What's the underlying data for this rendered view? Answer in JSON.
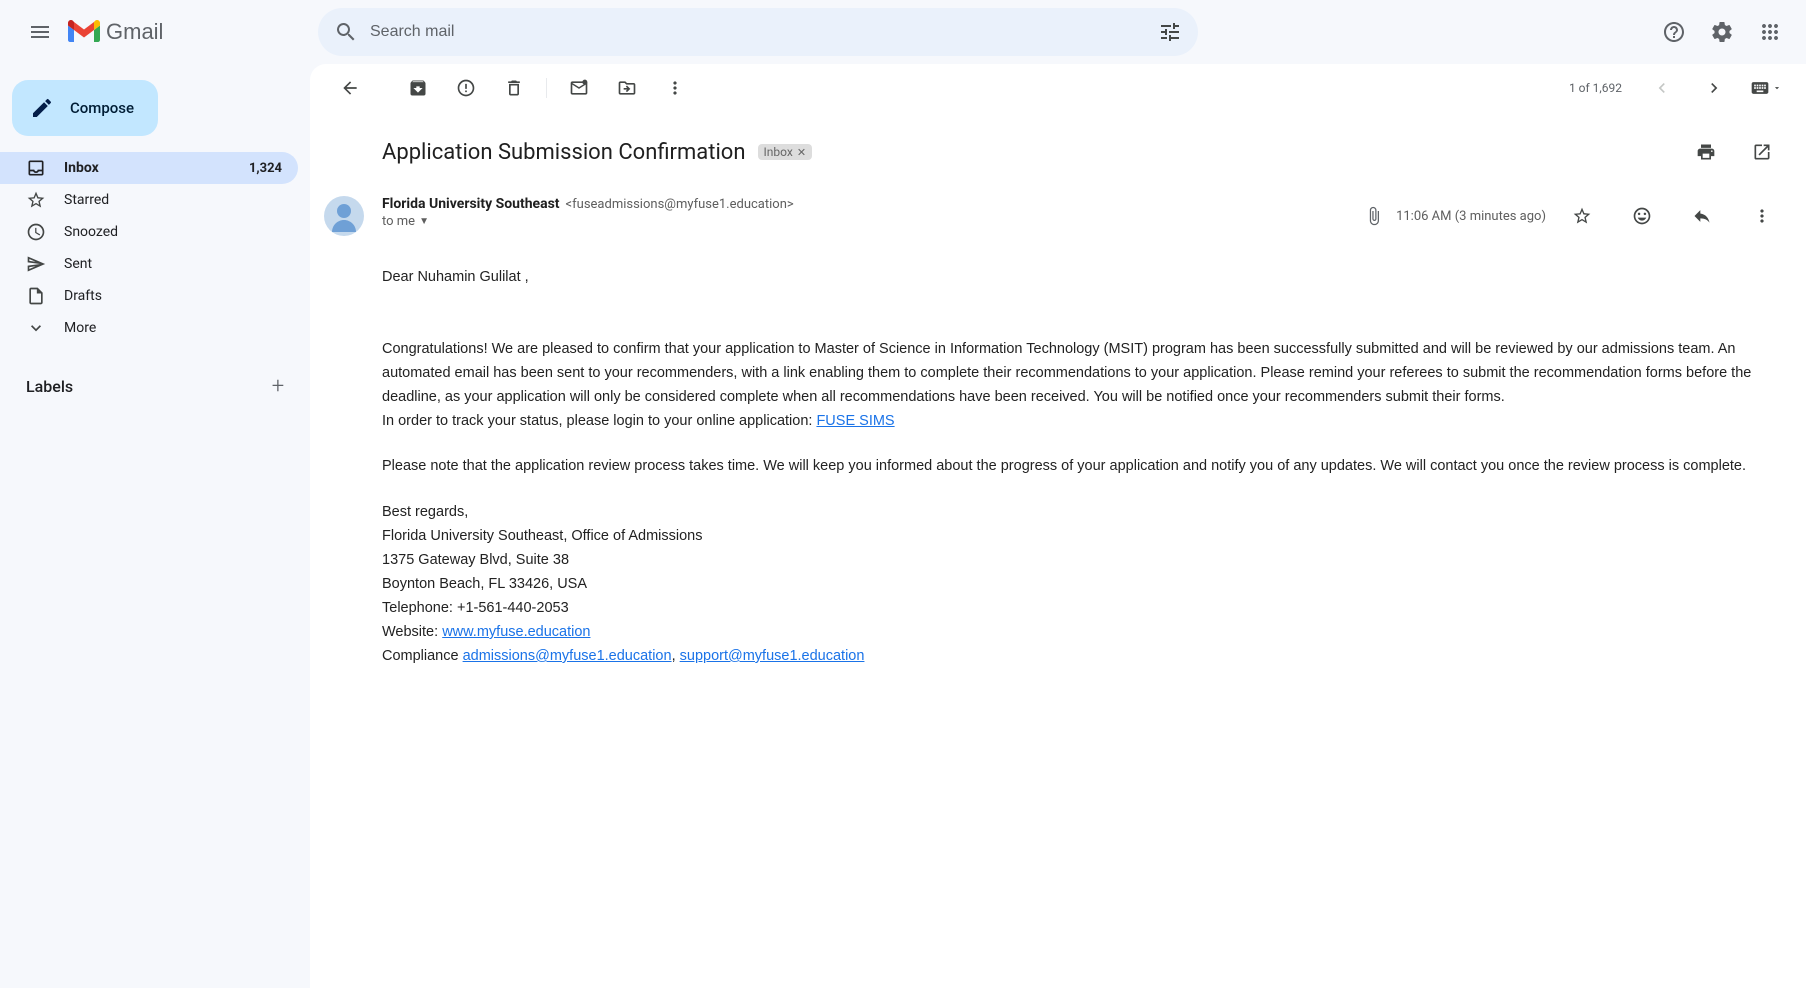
{
  "app": {
    "name": "Gmail"
  },
  "search": {
    "placeholder": "Search mail"
  },
  "compose": {
    "label": "Compose"
  },
  "nav": {
    "inbox": {
      "label": "Inbox",
      "count": "1,324"
    },
    "starred": {
      "label": "Starred"
    },
    "snoozed": {
      "label": "Snoozed"
    },
    "sent": {
      "label": "Sent"
    },
    "drafts": {
      "label": "Drafts"
    },
    "more": {
      "label": "More"
    }
  },
  "labels": {
    "header": "Labels"
  },
  "pagination": {
    "text": "1 of 1,692"
  },
  "email": {
    "subject": "Application Submission Confirmation",
    "chip": "Inbox",
    "sender_name": "Florida University Southeast",
    "sender_email": "<fuseadmissions@myfuse1.education>",
    "to_line": "to me",
    "time": "11:06 AM (3 minutes ago)",
    "greeting": "Dear Nuhamin Gulilat ,",
    "p1": "Congratulations! We are pleased to confirm that your application to Master of Science in Information Technology (MSIT) program has been successfully submitted and will be reviewed by our admissions team. An automated email has been sent to your recommenders, with a link enabling them to complete their recommendations to your application. Please remind your referees to submit the recommendation forms before the deadline, as your application will only be considered complete when all recommendations have been received. You will be notified once your recommenders submit their forms.",
    "p2_prefix": "In order to track your status, please login to your online application: ",
    "p2_link": "FUSE SIMS",
    "p3": "Please note that the application review process takes time. We will keep you informed about the progress of your application and notify you of any updates. We will contact you once the review process is complete.",
    "sig1": "Best regards,",
    "sig2": "Florida University Southeast, Office of Admissions",
    "sig3": "1375 Gateway Blvd, Suite 38",
    "sig4": "Boynton Beach, FL 33426, USA",
    "sig5": "Telephone: +1-561-440-2053",
    "sig6_prefix": "Website: ",
    "sig6_link": "www.myfuse.education",
    "sig7_prefix": "Compliance ",
    "sig7_link1": "admissions@myfuse1.education",
    "sig7_sep": ", ",
    "sig7_link2": "support@myfuse1.education"
  }
}
